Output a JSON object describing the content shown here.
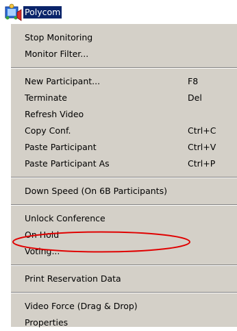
{
  "tree_node": {
    "label": "Polycom",
    "icon": "polycom-tree-icon"
  },
  "menu": {
    "groups": [
      {
        "items": [
          {
            "label": "Stop Monitoring",
            "shortcut": ""
          },
          {
            "label": "Monitor Filter...",
            "shortcut": ""
          }
        ]
      },
      {
        "items": [
          {
            "label": "New Participant...",
            "shortcut": "F8"
          },
          {
            "label": "Terminate",
            "shortcut": "Del"
          },
          {
            "label": "Refresh Video",
            "shortcut": ""
          },
          {
            "label": "Copy Conf.",
            "shortcut": "Ctrl+C"
          },
          {
            "label": "Paste Participant",
            "shortcut": "Ctrl+V"
          },
          {
            "label": "Paste Participant As",
            "shortcut": "Ctrl+P"
          }
        ]
      },
      {
        "items": [
          {
            "label": "Down Speed (On 6B Participants)",
            "shortcut": ""
          }
        ]
      },
      {
        "items": [
          {
            "label": "Unlock Conference",
            "shortcut": ""
          },
          {
            "label": "On Hold",
            "shortcut": ""
          },
          {
            "label": "Voting...",
            "shortcut": ""
          }
        ]
      },
      {
        "items": [
          {
            "label": "Print Reservation Data",
            "shortcut": ""
          }
        ]
      },
      {
        "items": [
          {
            "label": "Video Force (Drag & Drop)",
            "shortcut": ""
          },
          {
            "label": "Properties",
            "shortcut": ""
          }
        ]
      }
    ]
  },
  "annotation": {
    "shape": "ellipse",
    "color": "#e00000",
    "target": "Unlock Conference"
  },
  "colors": {
    "menu_bg": "#d4d0c8",
    "selection_bg": "#0a246a",
    "annotation": "#e00000"
  }
}
